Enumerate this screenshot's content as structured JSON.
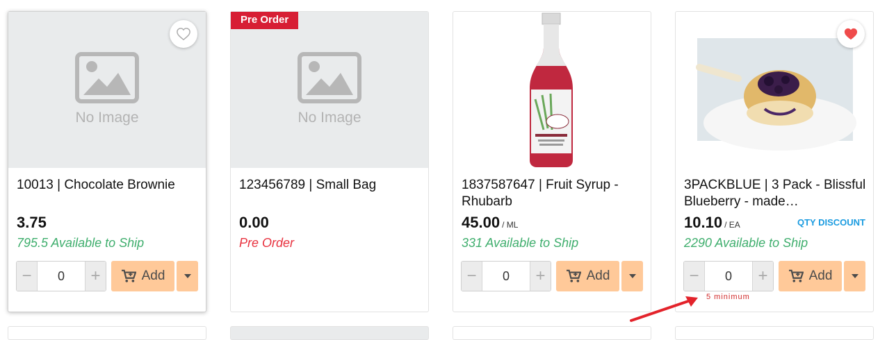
{
  "no_image_text": "No Image",
  "add_label": "Add",
  "min_hint": "5 minimum",
  "colors": {
    "stock": "#3fae6d",
    "preorder": "#e8323f",
    "add": "#ffc999",
    "qty_discount": "#1a9be0",
    "fav_active": "#ef4b4b"
  },
  "products": [
    {
      "title": "10013 | Chocolate Brownie",
      "price": "3.75",
      "unit": "",
      "stock": "795.5 Available to Ship",
      "qty": "0",
      "favorite": false
    },
    {
      "title": "123456789 | Small Bag",
      "price": "0.00",
      "unit": "",
      "stock": "Pre Order",
      "badge": "Pre Order"
    },
    {
      "title": "1837587647 | Fruit Syrup - Rhubarb",
      "price": "45.00",
      "unit": "/ ML",
      "stock": "331 Available to Ship",
      "qty": "0"
    },
    {
      "title": "3PACKBLUE | 3 Pack - Blissful Blueberry - made…",
      "price": "10.10",
      "unit": "/ EA",
      "stock": "2290 Available to Ship",
      "qty": "0",
      "qty_discount": "QTY DISCOUNT",
      "favorite": true
    }
  ]
}
